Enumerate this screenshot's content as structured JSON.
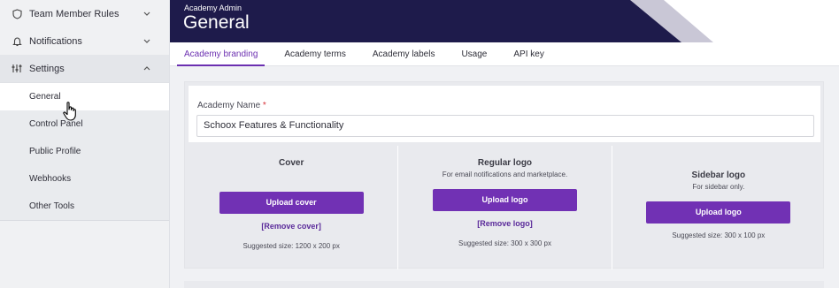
{
  "sidebar": {
    "items": [
      {
        "label": "Team Member Rules",
        "icon": "shield-icon"
      },
      {
        "label": "Notifications",
        "icon": "bell-icon"
      },
      {
        "label": "Settings",
        "icon": "sliders-icon"
      }
    ],
    "sub_items": [
      {
        "label": "General"
      },
      {
        "label": "Control Panel"
      },
      {
        "label": "Public Profile"
      },
      {
        "label": "Webhooks"
      },
      {
        "label": "Other Tools"
      }
    ]
  },
  "header": {
    "subtitle": "Academy Admin",
    "title": "General",
    "bg_color": "#1e1b4b"
  },
  "tabs": [
    {
      "label": "Academy branding",
      "active": true
    },
    {
      "label": "Academy terms"
    },
    {
      "label": "Academy labels"
    },
    {
      "label": "Usage"
    },
    {
      "label": "API key"
    }
  ],
  "form": {
    "name_label": "Academy Name",
    "required_mark": "*",
    "name_value": "Schoox Features & Functionality"
  },
  "uploads": {
    "cover": {
      "title": "Cover",
      "button": "Upload cover",
      "remove": "[Remove cover]",
      "suggested": "Suggested size: 1200 x 200 px"
    },
    "regular": {
      "title": "Regular logo",
      "desc": "For email notifications and marketplace.",
      "button": "Upload logo",
      "remove": "[Remove logo]",
      "suggested": "Suggested size: 300 x 300 px"
    },
    "sidebar": {
      "title": "Sidebar logo",
      "desc": "For sidebar only.",
      "button": "Upload logo",
      "suggested": "Suggested size: 300 x 100 px"
    }
  },
  "colors": {
    "accent": "#7131b4",
    "header_dark": "#1e1b4b"
  }
}
